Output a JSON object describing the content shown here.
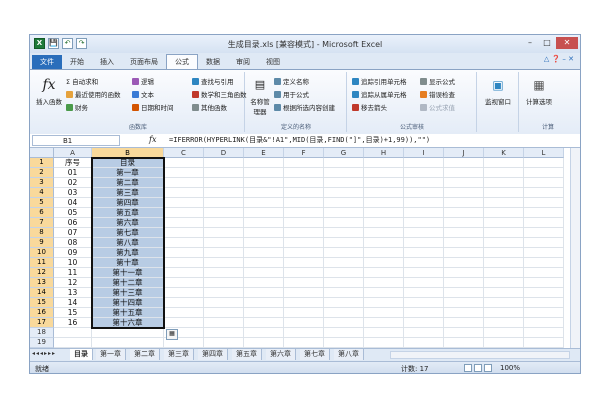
{
  "window": {
    "title": "生成目录.xls [兼容模式] - Microsoft Excel",
    "quick_access": [
      "X",
      "💾",
      "↶",
      "↷"
    ]
  },
  "tabs": [
    "文件",
    "开始",
    "插入",
    "页面布局",
    "公式",
    "数据",
    "审阅",
    "视图"
  ],
  "active_tab": "公式",
  "ribbon": {
    "insert_function": "插入函数",
    "autosum": "Σ 自动求和",
    "recent": "最近使用的函数",
    "financial": "财务",
    "logical": "逻辑",
    "text": "文本",
    "datetime": "日期和时间",
    "lookup": "查找与引用",
    "math": "数学和三角函数",
    "more": "其他函数",
    "group_library": "函数库",
    "name_manager": "名称管理器",
    "define_name": "定义名称",
    "use_in_formula": "用于公式",
    "create_from_sel": "根据所选内容创建",
    "group_names": "定义的名称",
    "trace_precedents": "追踪引用单元格",
    "trace_dependents": "追踪从属单元格",
    "remove_arrows": "移去箭头",
    "show_formulas": "显示公式",
    "error_check": "错误检查",
    "evaluate": "公式求值",
    "watch_window": "监视窗口",
    "group_auditing": "公式审核",
    "calc_options": "计算选项",
    "group_calc": "计算"
  },
  "formula_bar": {
    "name_box": "B1",
    "fx": "fx",
    "formula": "=IFERROR(HYPERLINK(目录&\"!A1\",MID(目录,FIND(\"]\",目录)+1,99)),\"\")"
  },
  "columns": [
    "A",
    "B",
    "C",
    "D",
    "E",
    "F",
    "G",
    "H",
    "I",
    "J",
    "K",
    "L"
  ],
  "rows": [
    {
      "n": "1",
      "a": "序号",
      "b": "目录"
    },
    {
      "n": "2",
      "a": "01",
      "b": "第一章"
    },
    {
      "n": "3",
      "a": "02",
      "b": "第二章"
    },
    {
      "n": "4",
      "a": "03",
      "b": "第三章"
    },
    {
      "n": "5",
      "a": "04",
      "b": "第四章"
    },
    {
      "n": "6",
      "a": "05",
      "b": "第五章"
    },
    {
      "n": "7",
      "a": "06",
      "b": "第六章"
    },
    {
      "n": "8",
      "a": "07",
      "b": "第七章"
    },
    {
      "n": "9",
      "a": "08",
      "b": "第八章"
    },
    {
      "n": "10",
      "a": "09",
      "b": "第九章"
    },
    {
      "n": "11",
      "a": "10",
      "b": "第十章"
    },
    {
      "n": "12",
      "a": "11",
      "b": "第十一章"
    },
    {
      "n": "13",
      "a": "12",
      "b": "第十二章"
    },
    {
      "n": "14",
      "a": "13",
      "b": "第十三章"
    },
    {
      "n": "15",
      "a": "14",
      "b": "第十四章"
    },
    {
      "n": "16",
      "a": "15",
      "b": "第十五章"
    },
    {
      "n": "17",
      "a": "16",
      "b": "第十六章"
    },
    {
      "n": "18",
      "a": "",
      "b": ""
    },
    {
      "n": "19",
      "a": "",
      "b": ""
    }
  ],
  "sheet_tabs": [
    "目录",
    "第一章",
    "第二章",
    "第三章",
    "第四章",
    "第五章",
    "第六章",
    "第七章",
    "第八章"
  ],
  "active_sheet": "目录",
  "status": {
    "mode": "就绪",
    "count": "计数: 17",
    "zoom": "100%"
  },
  "colors": {
    "selection_fill": "#b8cce4",
    "header_selected": "#f9d99b",
    "file_tab": "#2a6ebb"
  }
}
